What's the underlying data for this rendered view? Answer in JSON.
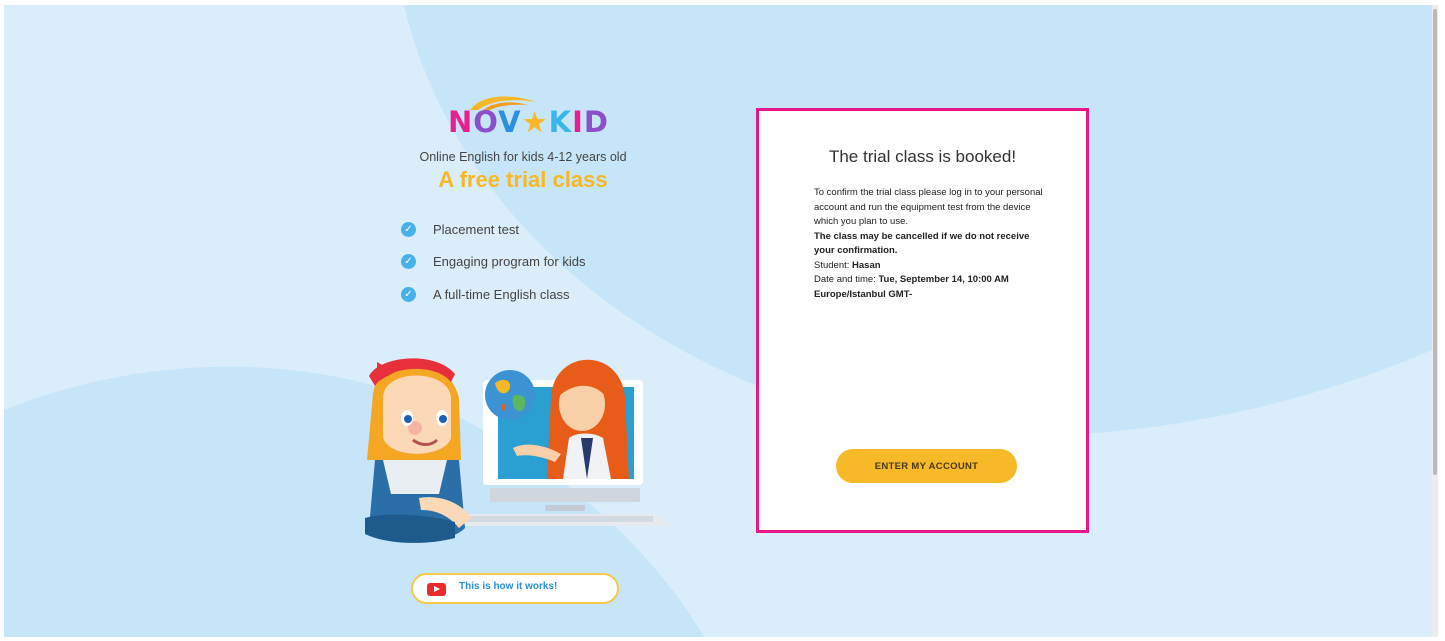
{
  "brand": {
    "logo_text": "NOVAKID",
    "tagline": "Online English for kids 4-12 years old",
    "headline": "A free trial class"
  },
  "features": [
    {
      "label": "Placement test",
      "icon": "check-icon"
    },
    {
      "label": "Engaging program for kids",
      "icon": "check-icon"
    },
    {
      "label": "A full-time English class",
      "icon": "check-icon"
    }
  ],
  "video_button": {
    "label": "This is how it works!",
    "icon": "youtube-play-icon"
  },
  "booking": {
    "title": "The trial class is booked!",
    "instructions": "To confirm the trial class please log in to your personal account and run the equipment test from the device which you plan to use.",
    "warning": "The class may be cancelled if we do not receive your confirmation.",
    "student_label": "Student:",
    "student_name": "Hasan",
    "datetime_label": "Date and time:",
    "datetime_value": "Tue, September 14, 10:00 AM Europe/Istanbul GMT-",
    "button_label": "ENTER MY ACCOUNT"
  },
  "colors": {
    "background": "#d9edfb",
    "background_shape": "#c6e5f8",
    "accent_yellow": "#f7b726",
    "check_blue": "#48b1e8",
    "highlight_border": "#e8158c",
    "youtube_red": "#ea2b2b"
  }
}
